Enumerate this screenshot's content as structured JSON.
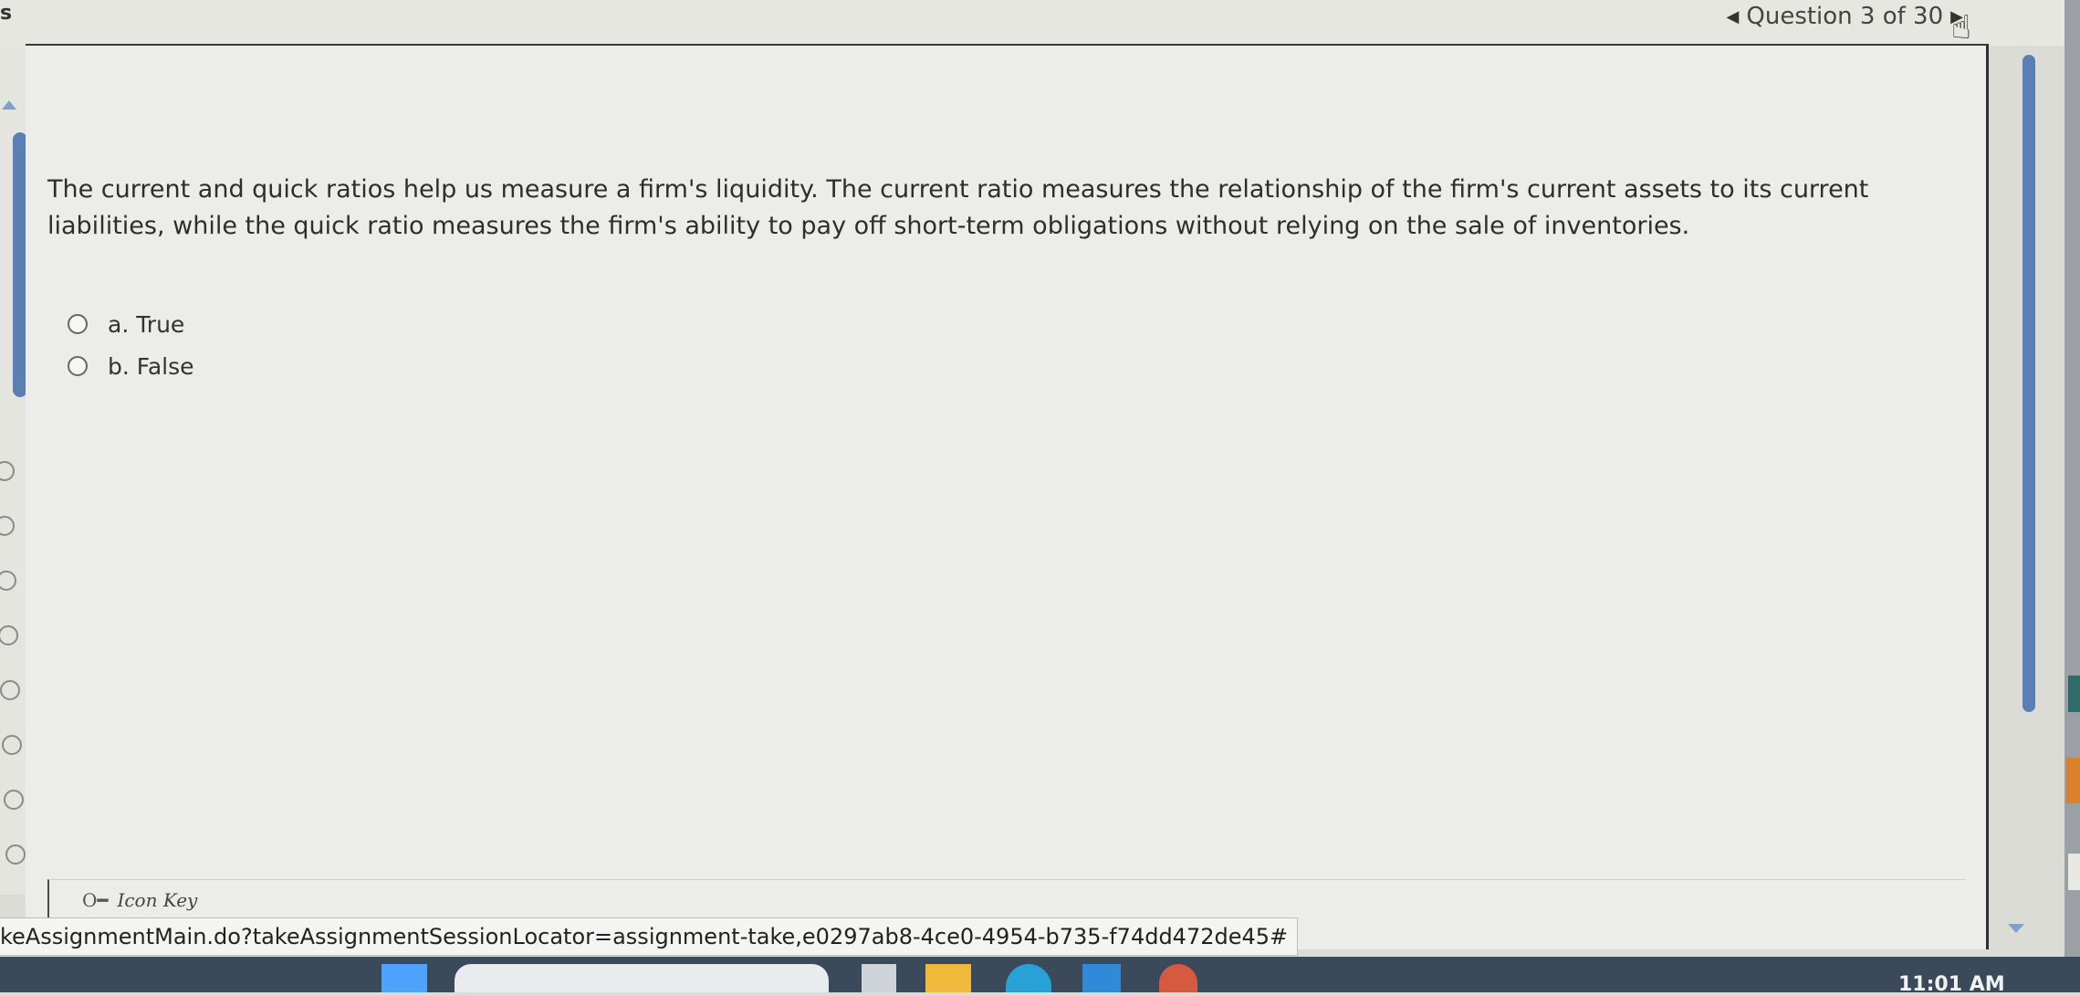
{
  "corner_letter": "s",
  "nav": {
    "question_label": "Question 3 of 30",
    "prev_icon": "triangle-left-icon",
    "next_icon": "triangle-right-icon"
  },
  "question": {
    "text": "The current and quick ratios help us measure a firm's liquidity. The current ratio measures the relationship of the firm's current assets to its current liabilities, while the quick ratio measures the firm's ability to pay off short-term obligations without relying on the sale of inventories.",
    "answers": [
      {
        "label": "a. True"
      },
      {
        "label": "b. False"
      }
    ]
  },
  "icon_key": {
    "label": "Icon Key",
    "icon": "key-icon"
  },
  "status_bar": {
    "url": "keAssignmentMain.do?takeAssignmentSessionLocator=assignment-take,e0297ab8-4ce0-4954-b735-f74dd472de45#"
  },
  "taskbar": {
    "clock": "11:01 AM"
  },
  "colors": {
    "accent": "#5a7fb4",
    "page_bg": "#ececea"
  }
}
